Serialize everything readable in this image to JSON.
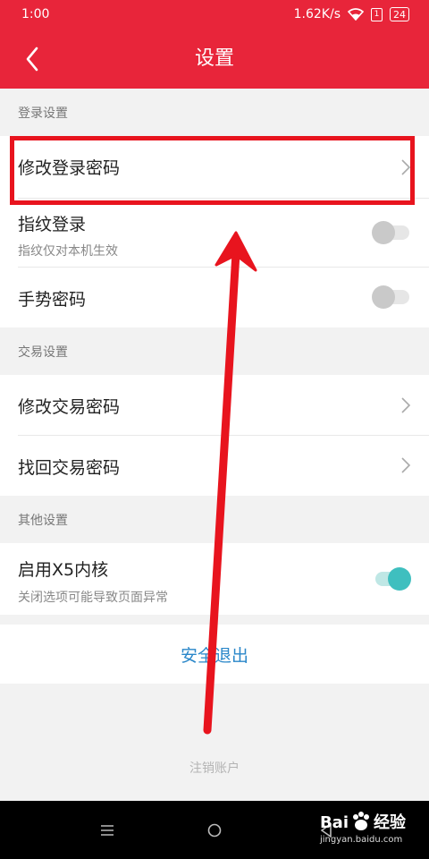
{
  "status_bar": {
    "time": "1:00",
    "speed": "1.62K/s",
    "sim": "1",
    "battery": "24"
  },
  "app_bar": {
    "title": "设置",
    "back_icon": "chevron-left-icon"
  },
  "sections": {
    "login": {
      "header": "登录设置"
    },
    "trade": {
      "header": "交易设置"
    },
    "other": {
      "header": "其他设置"
    }
  },
  "rows": {
    "change_login_password": {
      "title": "修改登录密码"
    },
    "fingerprint_login": {
      "title": "指纹登录",
      "subtitle": "指纹仅对本机生效",
      "enabled": false
    },
    "gesture_password": {
      "title": "手势密码",
      "enabled": false
    },
    "change_trade_password": {
      "title": "修改交易密码"
    },
    "recover_trade_password": {
      "title": "找回交易密码"
    },
    "enable_x5": {
      "title": "启用X5内核",
      "subtitle": "关闭选项可能导致页面异常",
      "enabled": true
    }
  },
  "actions": {
    "logout": "安全退出",
    "cancel_account": "注销账户"
  },
  "watermark": {
    "brand": "Bai",
    "brand_suffix": "经验",
    "url": "jingyan.baidu.com"
  },
  "colors": {
    "primary": "#e8253a",
    "link": "#2a87c9",
    "toggle_on": "#3fbfbf",
    "annotation": "#e8141e"
  }
}
